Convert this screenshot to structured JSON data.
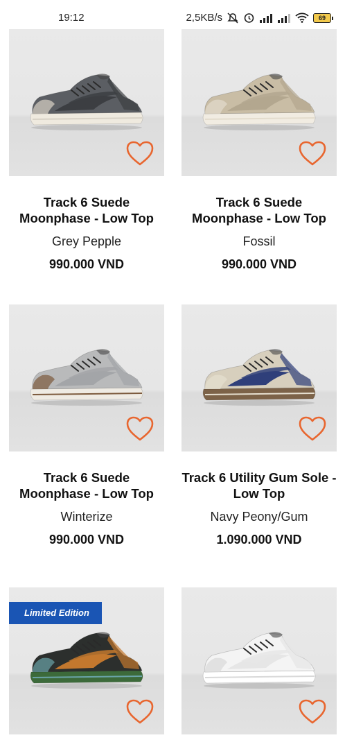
{
  "status_bar": {
    "time": "19:12",
    "net_speed": "2,5KB/s",
    "battery": "69"
  },
  "products": [
    {
      "name": "Track 6 Suede Moonphase - Low Top",
      "color": "Grey Pepple",
      "price": "990.000 VND",
      "shoe_colors": {
        "upper": "#5b5e63",
        "accent": "#3c3e42",
        "sole": "#efeadf",
        "trim": "#d8d2c6"
      }
    },
    {
      "name": "Track 6 Suede Moonphase - Low Top",
      "color": "Fossil",
      "price": "990.000 VND",
      "shoe_colors": {
        "upper": "#c9bda5",
        "accent": "#b3a78f",
        "sole": "#f1ece2",
        "trim": "#e3dccd"
      }
    },
    {
      "name": "Track 6 Suede Moonphase - Low Top",
      "color": "Winterize",
      "price": "990.000 VND",
      "shoe_colors": {
        "upper": "#b9babb",
        "accent": "#a3a5a8",
        "sole": "#efebe3",
        "trim": "#7c5a3c"
      }
    },
    {
      "name": "Track 6 Utility Gum Sole - Low Top",
      "color": "Navy Peony/Gum",
      "price": "1.090.000 VND",
      "shoe_colors": {
        "upper": "#d7cfbd",
        "accent": "#2f3f7a",
        "sole": "#7c6248",
        "trim": "#e6dfd0"
      }
    },
    {
      "name": "",
      "color": "",
      "price": "",
      "badge": "Limited Edition",
      "shoe_colors": {
        "upper": "#2c2f2d",
        "accent": "#c3782e",
        "sole": "#3c6a3a",
        "trim": "#6aa3a8"
      }
    },
    {
      "name": "",
      "color": "",
      "price": "",
      "shoe_colors": {
        "upper": "#f4f4f4",
        "accent": "#e6e6e6",
        "sole": "#ffffff",
        "trim": "#d9d9d9"
      }
    }
  ],
  "accent_heart_color": "#e8662f"
}
